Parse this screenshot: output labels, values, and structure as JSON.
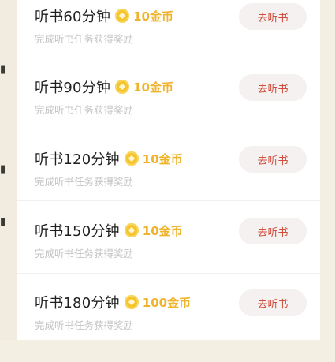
{
  "tasks": [
    {
      "title": "听书60分钟",
      "reward": "10金币",
      "desc": "完成听书任务获得奖励",
      "button": "去听书"
    },
    {
      "title": "听书90分钟",
      "reward": "10金币",
      "desc": "完成听书任务获得奖励",
      "button": "去听书"
    },
    {
      "title": "听书120分钟",
      "reward": "10金币",
      "desc": "完成听书任务获得奖励",
      "button": "去听书"
    },
    {
      "title": "听书150分钟",
      "reward": "10金币",
      "desc": "完成听书任务获得奖励",
      "button": "去听书"
    },
    {
      "title": "听书180分钟",
      "reward": "100金币",
      "desc": "完成听书任务获得奖励",
      "button": "去听书"
    }
  ],
  "colors": {
    "reward": "#f0b42c",
    "button_text": "#d24c3c",
    "button_bg": "#f4f1f0",
    "coin": "#f5c530"
  },
  "icons": {
    "reward_icon": "gold-coin-icon"
  }
}
